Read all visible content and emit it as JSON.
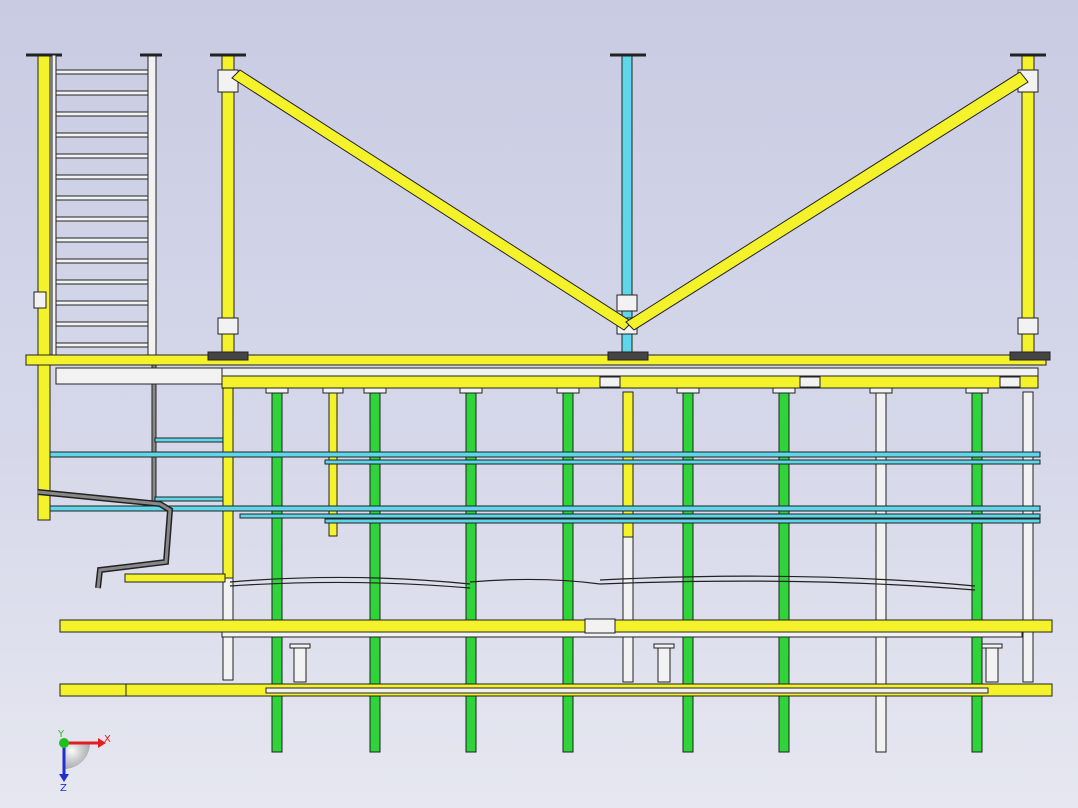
{
  "viewport": {
    "background_top": "#c9cbe3",
    "background_bottom": "#e6e7f0"
  },
  "colors": {
    "yellow": "#f4f22a",
    "cyan": "#5fd7ea",
    "green": "#2fd43b",
    "white": "#f2f2f2",
    "gray": "#b4b4b4",
    "outline": "#222222"
  },
  "triad": {
    "x_label": "X",
    "y_label": "Y",
    "z_label": "Z",
    "x_color": "#e02020",
    "y_color": "#20c020",
    "z_color": "#2030d0"
  }
}
